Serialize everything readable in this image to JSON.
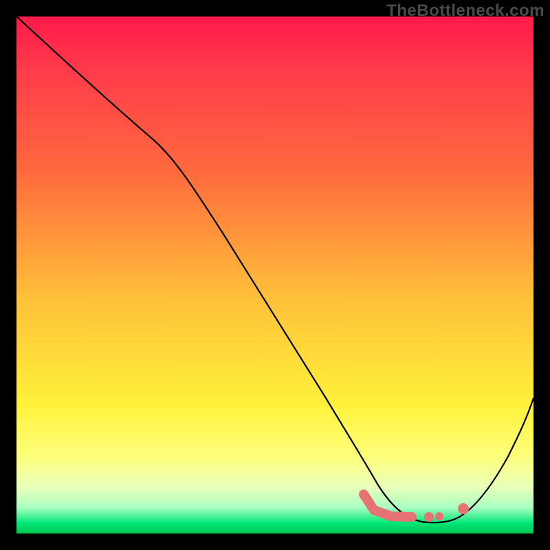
{
  "watermark": "TheBottleneck.com",
  "colors": {
    "gradient_top": "#ff1a4b",
    "gradient_bottom": "#00c853",
    "curve": "#000000",
    "marker": "#e57373",
    "frame_bg": "#000000"
  },
  "chart_data": {
    "type": "line",
    "title": "",
    "xlabel": "",
    "ylabel": "",
    "xlim": [
      0,
      100
    ],
    "ylim": [
      0,
      100
    ],
    "grid": false,
    "legend": false,
    "annotations": [],
    "series": [
      {
        "name": "bottleneck-curve",
        "x": [
          0,
          10,
          20,
          27,
          35,
          45,
          55,
          62,
          67,
          70,
          73,
          76,
          80,
          83,
          86,
          90,
          95,
          100
        ],
        "y": [
          100,
          91,
          82,
          76,
          64,
          48,
          32,
          21,
          13,
          9,
          6,
          4,
          3,
          3,
          4,
          9,
          18,
          30
        ]
      }
    ],
    "markers": {
      "name": "optimal-region",
      "points": [
        {
          "x": 67,
          "y": 6
        },
        {
          "x": 70,
          "y": 4
        },
        {
          "x": 73,
          "y": 3
        },
        {
          "x": 76,
          "y": 3
        },
        {
          "x": 80,
          "y": 3
        },
        {
          "x": 83,
          "y": 3
        },
        {
          "x": 86,
          "y": 4
        }
      ]
    }
  }
}
